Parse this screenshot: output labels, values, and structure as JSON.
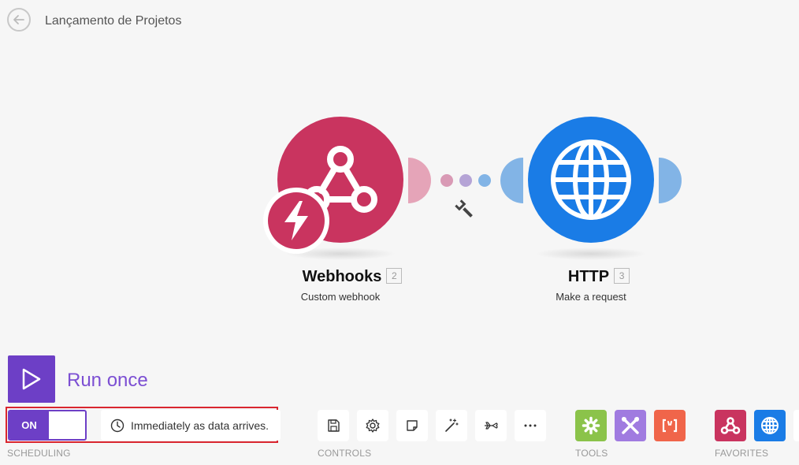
{
  "header": {
    "title": "Lançamento de Projetos",
    "back_icon": "arrow-left-icon"
  },
  "modules": [
    {
      "name": "Webhooks",
      "number": "2",
      "subtitle": "Custom webhook",
      "color": "#c9345f",
      "icon": "webhook-icon",
      "badge_icon": "lightning-icon"
    },
    {
      "name": "HTTP",
      "number": "3",
      "subtitle": "Make a request",
      "color": "#1a7ce6",
      "icon": "globe-icon"
    }
  ],
  "connector": {
    "icon": "wrench-icon"
  },
  "run": {
    "label": "Run once",
    "icon": "play-icon"
  },
  "scheduling": {
    "label": "SCHEDULING",
    "toggle_state": "ON",
    "schedule_text": "Immediately as data arrives.",
    "clock_icon": "clock-icon"
  },
  "controls": {
    "label": "CONTROLS",
    "items": [
      "save-icon",
      "gear-icon",
      "note-icon",
      "magic-wand-icon",
      "airplane-icon",
      "more-icon"
    ]
  },
  "tools": {
    "label": "TOOLS",
    "items": [
      {
        "icon": "gear-icon",
        "color": "#8bc34a"
      },
      {
        "icon": "tools-icon",
        "color": "#a07be0"
      },
      {
        "icon": "text-parser-icon",
        "color": "#f0654a"
      }
    ]
  },
  "favorites": {
    "label": "FAVORITES",
    "items": [
      {
        "icon": "webhook-icon",
        "color": "#c9345f"
      },
      {
        "icon": "globe-icon",
        "color": "#1a7ce6"
      }
    ]
  }
}
